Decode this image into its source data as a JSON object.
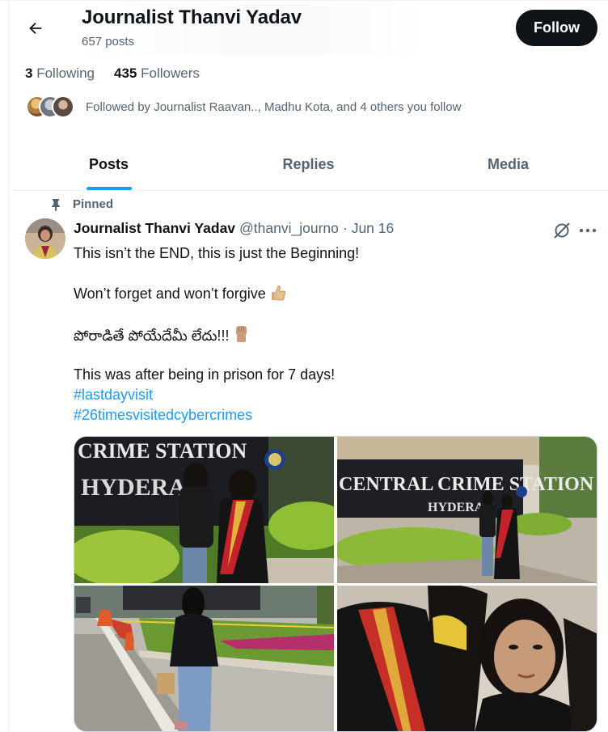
{
  "profile": {
    "name": "Journalist Thanvi Yadav",
    "post_count": "657 posts",
    "follow_label": "Follow"
  },
  "stats": {
    "following_count": "3",
    "following_label": "Following",
    "followers_count": "435",
    "followers_label": "Followers"
  },
  "followed_by": "Followed by Journalist Raavan.., Madhu Kota, and 4 others you follow",
  "tabs": [
    {
      "label": "Posts",
      "active": true
    },
    {
      "label": "Replies",
      "active": false
    },
    {
      "label": "Media",
      "active": false
    }
  ],
  "tweet": {
    "pinned_label": "Pinned",
    "author_name": "Journalist Thanvi Yadav",
    "handle": "@thanvi_journo",
    "separator": "·",
    "date": "Jun 16",
    "lines": [
      "This isn’t the END, this is just the Beginning!",
      "Won’t forget and won’t forgive",
      "పోరాడితే పోయేదేమీ లేదు!!!",
      "This was after being in prison for 7 days!"
    ],
    "hashtags": [
      "#lastdayvisit",
      "#26timesvisitedcybercrimes"
    ],
    "emojis": [
      "thumbs-up-emoji",
      "raised-fist-emoji"
    ],
    "photo_signs": [
      "CRIME STATION",
      "HYDERA",
      "CENTRAL CRIME STATION",
      "HYDERA"
    ]
  },
  "colors": {
    "accent": "#1d9bf0",
    "text": "#0f1419",
    "muted": "#536471",
    "divider": "#eff3f4"
  }
}
